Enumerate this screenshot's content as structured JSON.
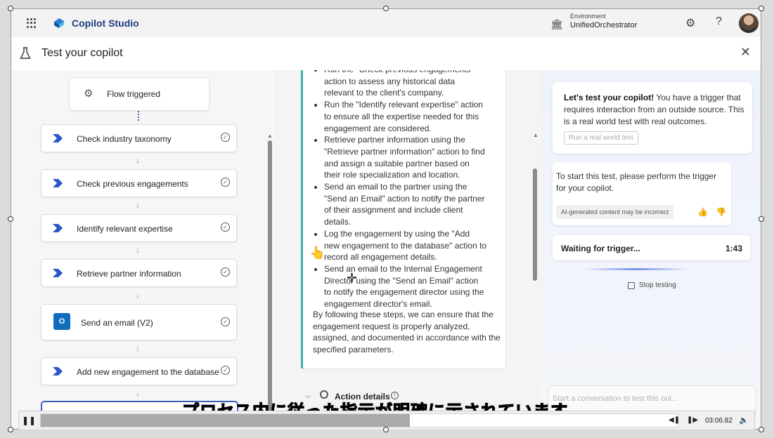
{
  "app": {
    "title": "Copilot Studio"
  },
  "environment": {
    "label": "Environment",
    "name": "UnifiedOrchestrator"
  },
  "panel": {
    "title": "Test your copilot"
  },
  "flow": {
    "trigger_label": "Flow triggered",
    "steps": [
      {
        "label": "Check industry taxonomy",
        "icon": "chevron-brand-icon"
      },
      {
        "label": "Check previous engagements",
        "icon": "chevron-brand-icon"
      },
      {
        "label": "Identify relevant expertise",
        "icon": "chevron-brand-icon"
      },
      {
        "label": "Retrieve partner information",
        "icon": "chevron-brand-icon"
      },
      {
        "label": "Send an email (V2)",
        "icon": "outlook-icon"
      },
      {
        "label": "Add new engagement to the database",
        "icon": "chevron-brand-icon"
      }
    ]
  },
  "message": {
    "bullets": [
      "Run the \"Check previous engagements\" action to assess any historical data relevant to the client's company.",
      "Run the \"Identify relevant expertise\" action to ensure all the expertise needed for this engagement are considered.",
      "Retrieve partner information using the \"Retrieve partner information\" action to find and assign a suitable partner based on their role specialization and location.",
      "Send an email to the partner using the \"Send an Email\" action to notify the partner of their assignment and include client details.",
      "Log the engagement by using the \"Add new engagement to the database\" action to record all engagement details.",
      "Send an email to the Internal Engagement Director using the \"Send an Email\" action to notify the engagement director using the engagement director's email."
    ],
    "conclusion": "By following these steps, we can ensure that the engagement request is properly analyzed, assigned, and documented in accordance with the specified parameters.",
    "action_details": "Action details"
  },
  "chat": {
    "intro_bold": "Let's test your copilot!",
    "intro_text": " You have a trigger that requires interaction from an outside source. This is a real world test with real outcomes.",
    "run_button": "Run a real world test",
    "instruction": "To start this test, please perform the trigger for your copilot.",
    "ai_notice": "AI-generated content may be incorrect",
    "waiting": "Waiting for trigger...",
    "timer": "1:43",
    "stop": "Stop testing",
    "input_placeholder": "Start a conversation to test this out..."
  },
  "video": {
    "subtitle": "プロセス内に従った指示が明確に示されています",
    "timecode": "03:06.82",
    "progress": 0.58
  },
  "colors": {
    "brand": "#1f3b82",
    "accent_teal": "#35b3a6",
    "outlook": "#0f6cbd"
  }
}
